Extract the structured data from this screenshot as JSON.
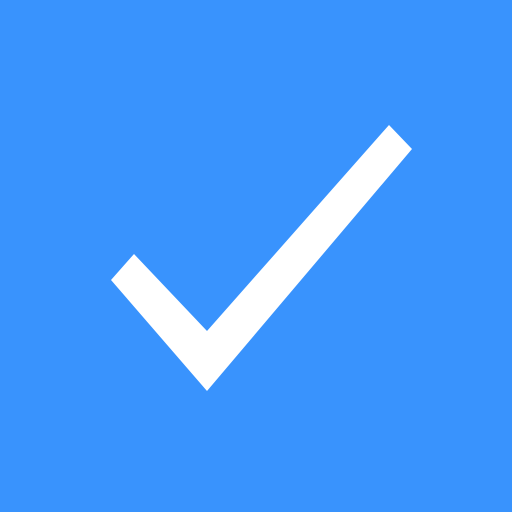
{
  "icon": {
    "name": "checkmark-icon",
    "background_color": "#3993fd",
    "glyph_color": "#ffffff"
  }
}
